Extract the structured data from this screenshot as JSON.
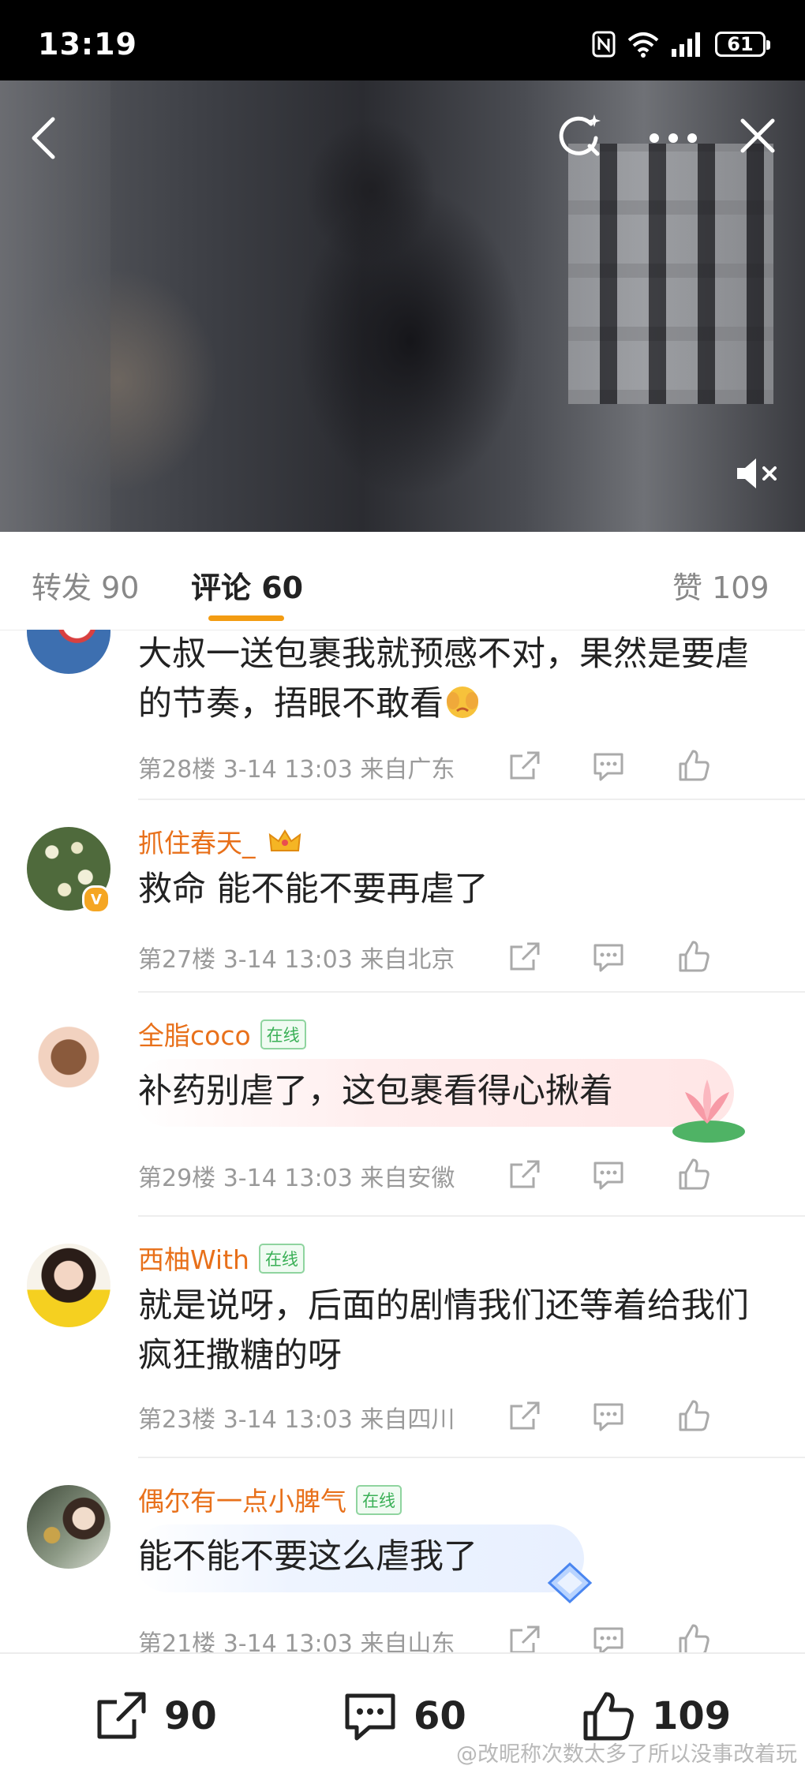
{
  "status_bar": {
    "time": "13:19",
    "battery": "61"
  },
  "tabs": [
    {
      "label": "转发 90"
    },
    {
      "label": "评论 60"
    },
    {
      "label": "赞 109"
    }
  ],
  "comments": [
    {
      "text": "大叔一送包裹我就预感不对，果然是要虐的节奏，捂眼不敢看",
      "meta": "第28楼 3-14 13:03 来自广东"
    },
    {
      "user": "抓住春天_",
      "text": "救命 能不能不要再虐了",
      "meta": "第27楼 3-14 13:03 来自北京"
    },
    {
      "user": "全脂coco",
      "badge": "在线",
      "text": "补药别虐了，这包裹看得心揪着",
      "meta": "第29楼 3-14 13:03 来自安徽"
    },
    {
      "user": "西柚With",
      "badge": "在线",
      "text": "就是说呀，后面的剧情我们还等着给我们疯狂撒糖的呀",
      "meta": "第23楼 3-14 13:03 来自四川"
    },
    {
      "user": "偶尔有一点小脾气",
      "badge": "在线",
      "text": "能不能不要这么虐我了",
      "meta": "第21楼 3-14 13:03 来自山东"
    }
  ],
  "bottom_bar": {
    "repost_count": "90",
    "comment_count": "60",
    "like_count": "109"
  },
  "watermark": "@改昵称次数太多了所以没事改着玩",
  "colors": {
    "accent": "#f39c12",
    "username": "#e8701a",
    "online": "#3bb057",
    "text": "#222222",
    "meta": "#9a9a9a"
  }
}
